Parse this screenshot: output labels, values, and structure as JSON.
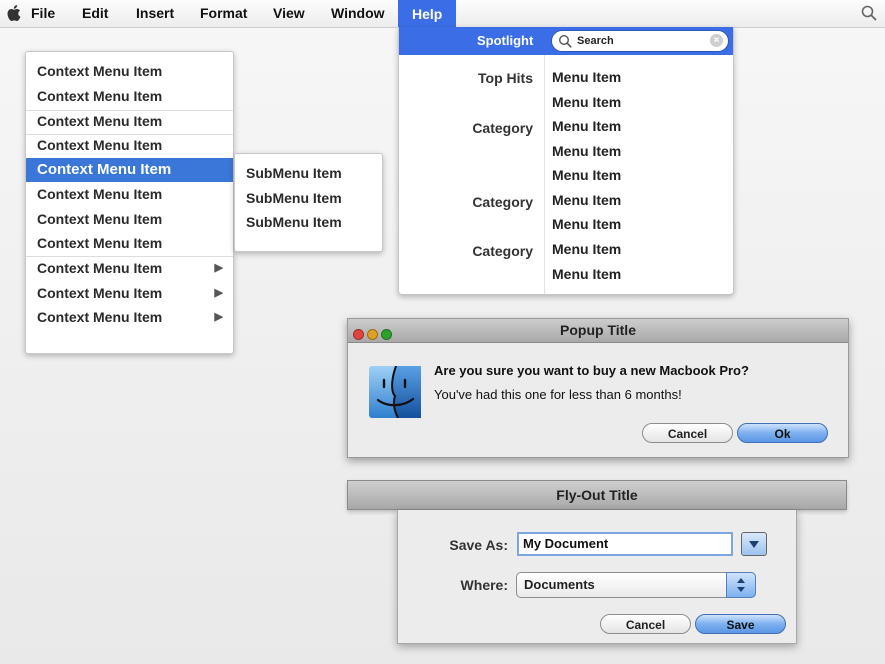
{
  "menubar": {
    "items": [
      "File",
      "Edit",
      "Insert",
      "Format",
      "View",
      "Window"
    ],
    "active": "Help"
  },
  "context_menu": {
    "items": [
      "Context Menu Item",
      "Context Menu Item",
      "Context Menu Item",
      "Context Menu Item",
      "Context Menu Item",
      "Context Menu Item",
      "Context Menu Item",
      "Context Menu Item",
      "Context Menu Item",
      "Context Menu Item",
      "Context Menu Item"
    ],
    "selected_index": 4,
    "submenu_arrow": "▶"
  },
  "submenu": {
    "items": [
      "SubMenu Item",
      "SubMenu Item",
      "SubMenu Item"
    ]
  },
  "spotlight": {
    "label": "Spotlight",
    "search_placeholder": "Search",
    "clear_glyph": "×",
    "categories": [
      "Top Hits",
      "Category",
      "Category",
      "Category"
    ],
    "results": [
      "Menu Item",
      "Menu Item",
      "Menu Item",
      "Menu Item",
      "Menu Item",
      "Menu Item",
      "Menu Item",
      "Menu Item",
      "Menu Item"
    ]
  },
  "popup": {
    "title": "Popup Title",
    "message": "Are you sure you want to buy a new Macbook Pro?",
    "detail": "You've had this one for less than 6 months!",
    "cancel_label": "Cancel",
    "ok_label": "Ok",
    "lights": {
      "close": "#e0443e",
      "minimize": "#dea123",
      "zoom": "#2ea12b"
    }
  },
  "flyout": {
    "title": "Fly-Out Title",
    "save_as_label": "Save As:",
    "filename_value": "My Document",
    "where_label": "Where:",
    "location_value": "Documents",
    "cancel_label": "Cancel",
    "save_label": "Save"
  },
  "colors": {
    "accent": "#3b6ee6",
    "selection": "#3a77d9"
  }
}
